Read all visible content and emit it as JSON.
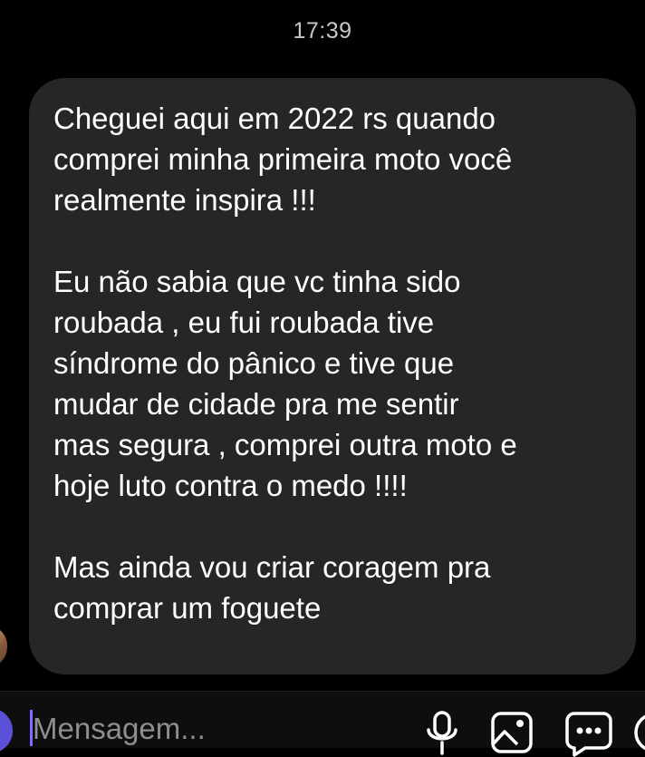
{
  "header": {
    "time": "17:39"
  },
  "message": {
    "paragraphs": [
      "Cheguei aqui em 2022 rs quando\ncomprei minha primeira moto você\nrealmente inspira !!!",
      "Eu não sabia que vc tinha sido\nroubada , eu fui roubada tive\nsíndrome do pânico e tive que\nmudar de cidade pra me sentir\nmas segura , comprei outra moto e\nhoje luto contra o medo !!!!",
      "Mas ainda vou criar coragem pra\ncomprar um foguete"
    ]
  },
  "composer": {
    "placeholder": "Mensagem...",
    "icons": [
      "camera-icon",
      "microphone-icon",
      "image-icon",
      "sticker-icon",
      "plus-icon"
    ]
  },
  "colors": {
    "background": "#000000",
    "bubble": "#262626",
    "text": "#ffffff",
    "timestamp": "#c7c7c7",
    "placeholder": "#8e8e8e",
    "accent": "#5b51d8"
  }
}
